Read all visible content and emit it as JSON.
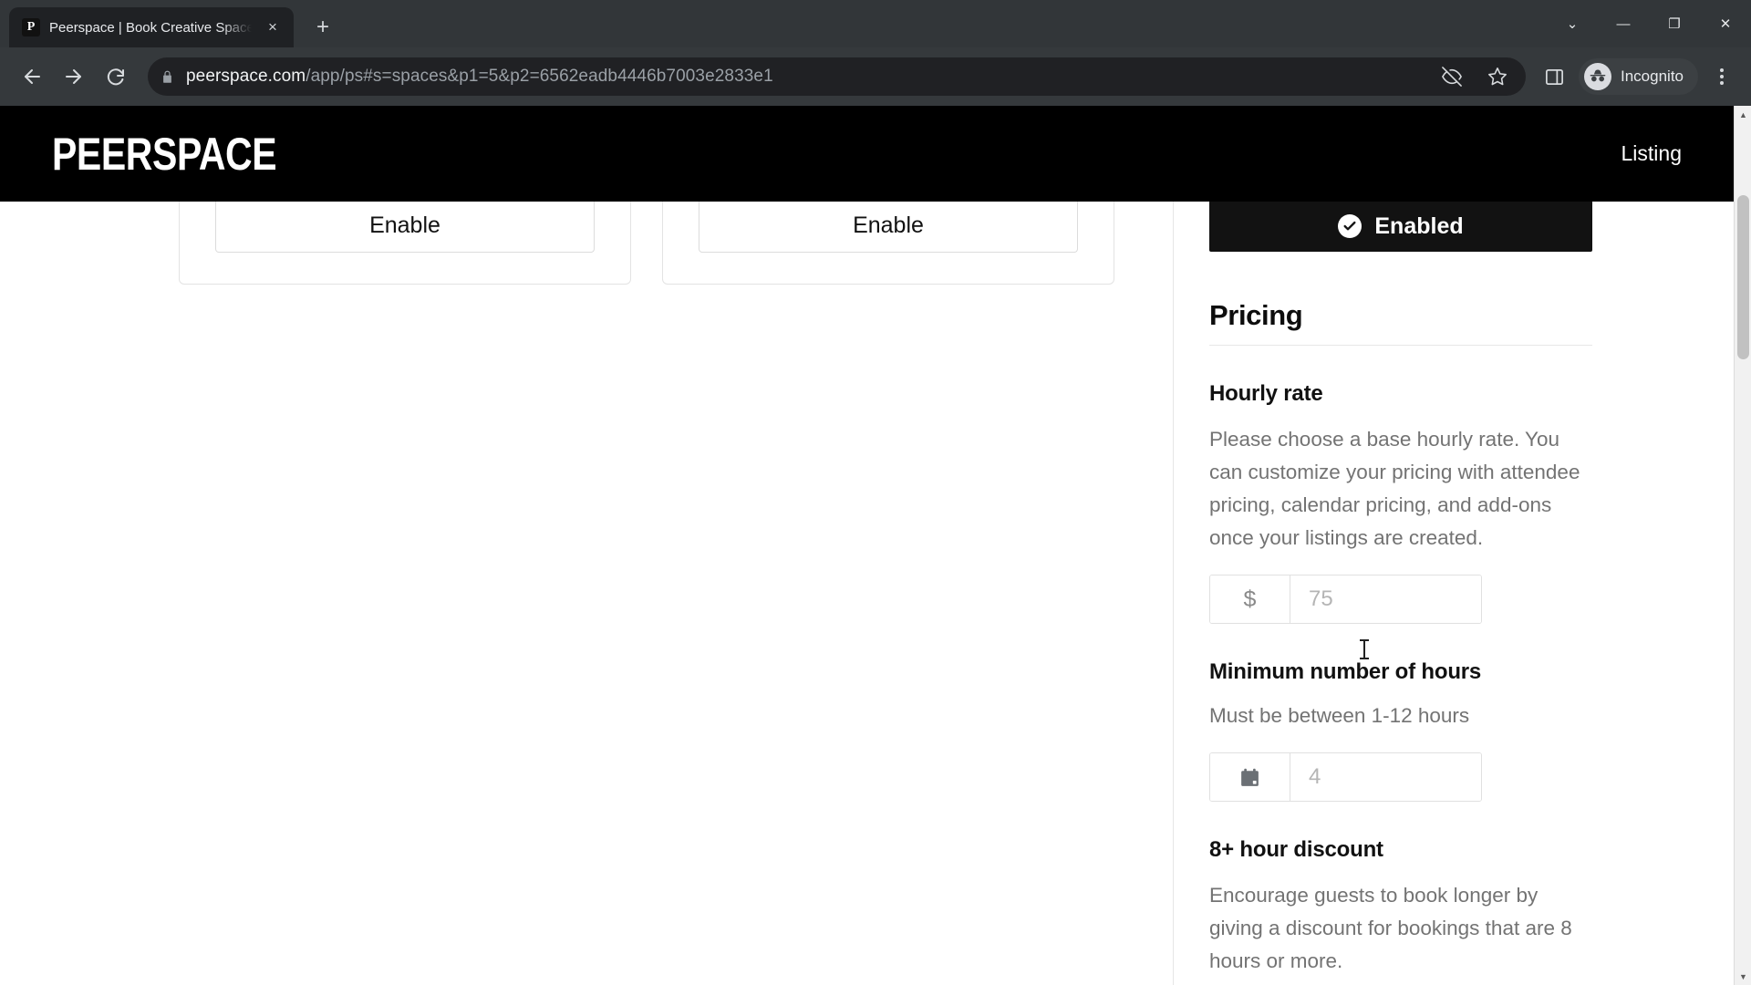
{
  "browser": {
    "tab": {
      "favicon_letter": "P",
      "title": "Peerspace | Book Creative Space",
      "close_icon": "×"
    },
    "new_tab_icon": "+",
    "window_controls": {
      "minimize_group": "⌄",
      "minimize": "—",
      "maximize": "❐",
      "close": "✕"
    },
    "omnibox": {
      "url_domain": "peerspace.com",
      "url_path": "/app/ps#s=spaces&p1=5&p2=6562eadb4446b7003e2833e1",
      "lock_icon": "padlock-icon"
    },
    "toolbar": {
      "back_icon": "back-arrow-icon",
      "forward_icon": "forward-arrow-icon",
      "reload_icon": "reload-icon",
      "third_party_cookies_icon": "eye-slash-icon",
      "bookmark_icon": "star-icon",
      "side_panel_icon": "side-panel-icon",
      "incognito_label": "Incognito",
      "menu_icon": "three-dot-menu-icon"
    }
  },
  "site": {
    "logo": "PEERSPACE",
    "nav": [
      {
        "label": "Listing"
      }
    ]
  },
  "main": {
    "cards": [
      {
        "button_label": "Enable"
      },
      {
        "button_label": "Enable"
      }
    ]
  },
  "panel": {
    "enabled_button": {
      "label": "Enabled",
      "icon": "check-circle-icon",
      "background": "#121212"
    },
    "section_title": "Pricing",
    "fields": [
      {
        "label": "Hourly rate",
        "description": "Please choose a base hourly rate. You can customize your pricing with attendee pricing, calendar pricing, and add-ons once your listings are created.",
        "prefix": "$",
        "prefix_icon": "dollar-sign",
        "value": "",
        "placeholder": "75"
      },
      {
        "label": "Minimum number of hours",
        "description": "Must be between 1-12 hours",
        "prefix": "",
        "prefix_icon": "calendar-icon",
        "value": "",
        "placeholder": "4"
      },
      {
        "label": "8+ hour discount",
        "description": "Encourage guests to book longer by giving a discount for bookings that are 8 hours or more."
      }
    ]
  },
  "colors": {
    "accent_black": "#000000",
    "panel_button": "#121212",
    "muted_text": "#737373",
    "placeholder": "#b5b5b5"
  }
}
